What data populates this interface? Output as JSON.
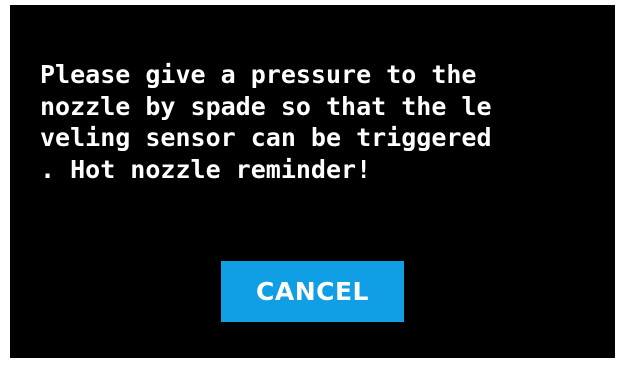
{
  "dialog": {
    "message_lines": [
      "Please give a pressure to the",
      "nozzle by spade so that the le",
      "veling sensor can be triggered",
      ". Hot nozzle reminder!"
    ],
    "cancel_label": "CANCEL"
  },
  "colors": {
    "background": "#000000",
    "text": "#ffffff",
    "button": "#109ee4",
    "frame": "#ffffff"
  }
}
